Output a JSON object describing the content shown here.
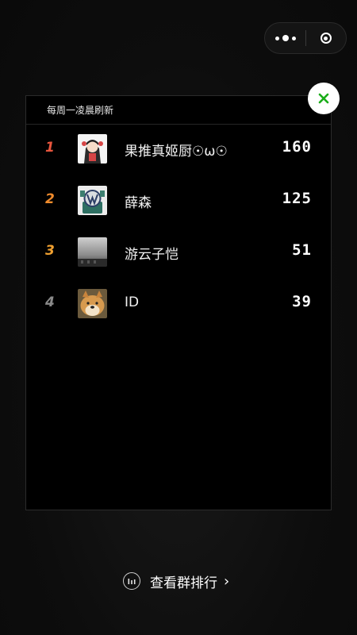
{
  "panel": {
    "header": "每周一凌晨刷新"
  },
  "rankings": [
    {
      "rank": "1",
      "name": "果推真姬厨☉ω☉",
      "score": "160",
      "rank_color": "#e8553d"
    },
    {
      "rank": "2",
      "name": "薛森",
      "score": "125",
      "rank_color": "#f08b2c"
    },
    {
      "rank": "3",
      "name": "游云子恺",
      "score": "51",
      "rank_color": "#f0a030"
    },
    {
      "rank": "4",
      "name": "ID",
      "score": "39",
      "rank_color": "#8a8a8a"
    }
  ],
  "footer": {
    "link_label": "查看群排行"
  },
  "icons": {
    "close": "close-icon",
    "capsule_more": "more-dots-icon",
    "capsule_exit": "exit-target-icon",
    "group_rank": "bar-chart-icon",
    "chevron": "chevron-right-icon"
  },
  "colors": {
    "close_x": "#1aad19",
    "panel_bg": "#000000",
    "page_bg": "#0d0d0d"
  }
}
